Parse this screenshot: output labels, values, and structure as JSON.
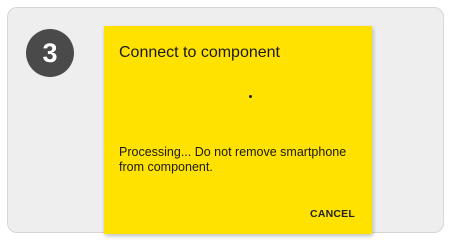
{
  "step": {
    "number": "3"
  },
  "dialog": {
    "title": "Connect to component",
    "message": "Processing... Do not remove smartphone from component.",
    "cancel_label": "CANCEL"
  },
  "colors": {
    "dialog_background": "#ffe200",
    "badge_background": "#4a4a4a",
    "card_background": "#eeeeee"
  },
  "icons": {
    "progress": "progress-spinner-icon"
  }
}
